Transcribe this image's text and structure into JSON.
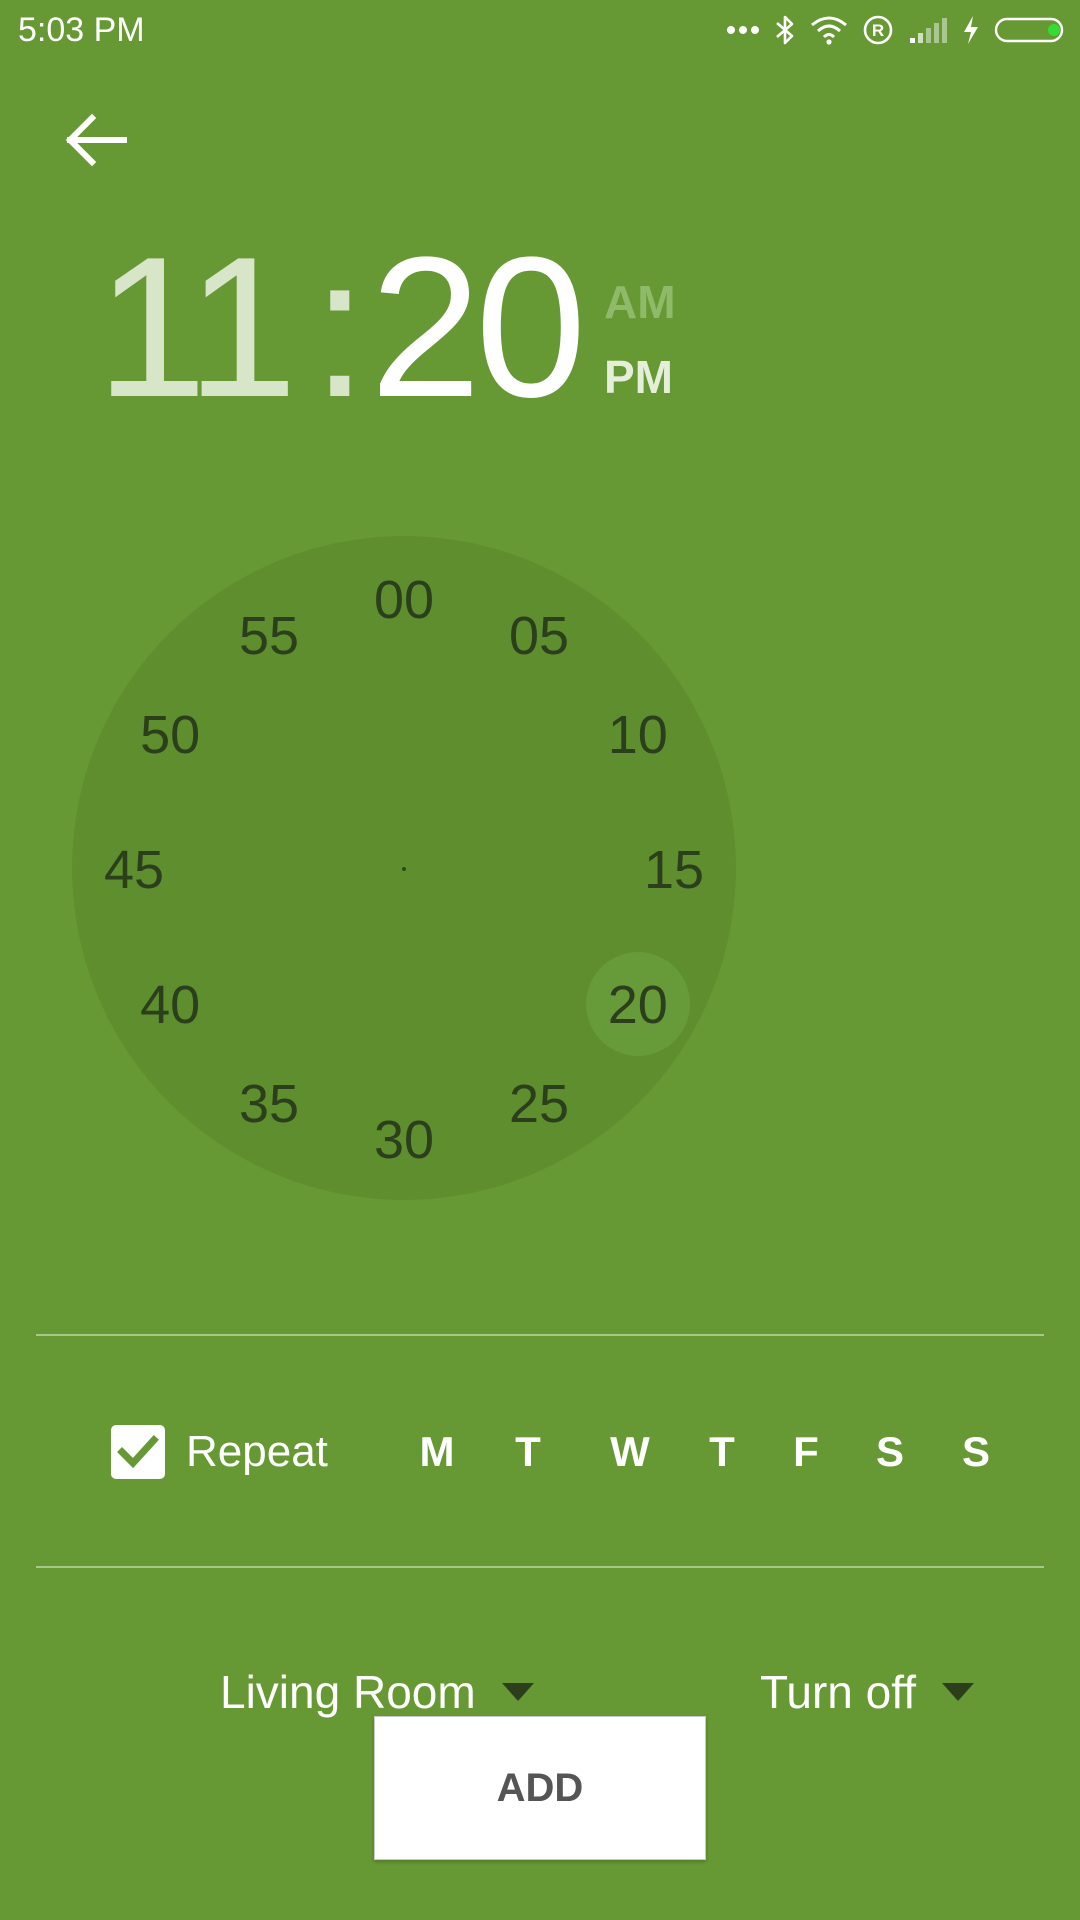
{
  "status_bar": {
    "time": "5:03 PM",
    "icons": [
      "more-dots-icon",
      "bluetooth-icon",
      "wifi-icon",
      "registered-icon",
      "signal-icon",
      "charging-icon",
      "battery-icon"
    ]
  },
  "header": {
    "back_icon": "arrow-left-icon"
  },
  "time_picker": {
    "hours": "11",
    "separator": ":",
    "minutes": "20",
    "am_label": "AM",
    "pm_label": "PM",
    "selected_period": "PM",
    "selected_minute": "20",
    "dial_numbers": [
      "00",
      "05",
      "10",
      "15",
      "20",
      "25",
      "30",
      "35",
      "40",
      "45",
      "50",
      "55"
    ]
  },
  "repeat": {
    "checked": true,
    "label": "Repeat",
    "days": [
      "M",
      "T",
      "W",
      "T",
      "F",
      "S",
      "S"
    ]
  },
  "device_dropdown": {
    "label": "Living Room"
  },
  "action_dropdown": {
    "label": "Turn off"
  },
  "add_button": {
    "label": "ADD"
  },
  "colors": {
    "background": "#669933",
    "dial": "#5e8e2e",
    "dial_text": "#2b3f1c"
  }
}
